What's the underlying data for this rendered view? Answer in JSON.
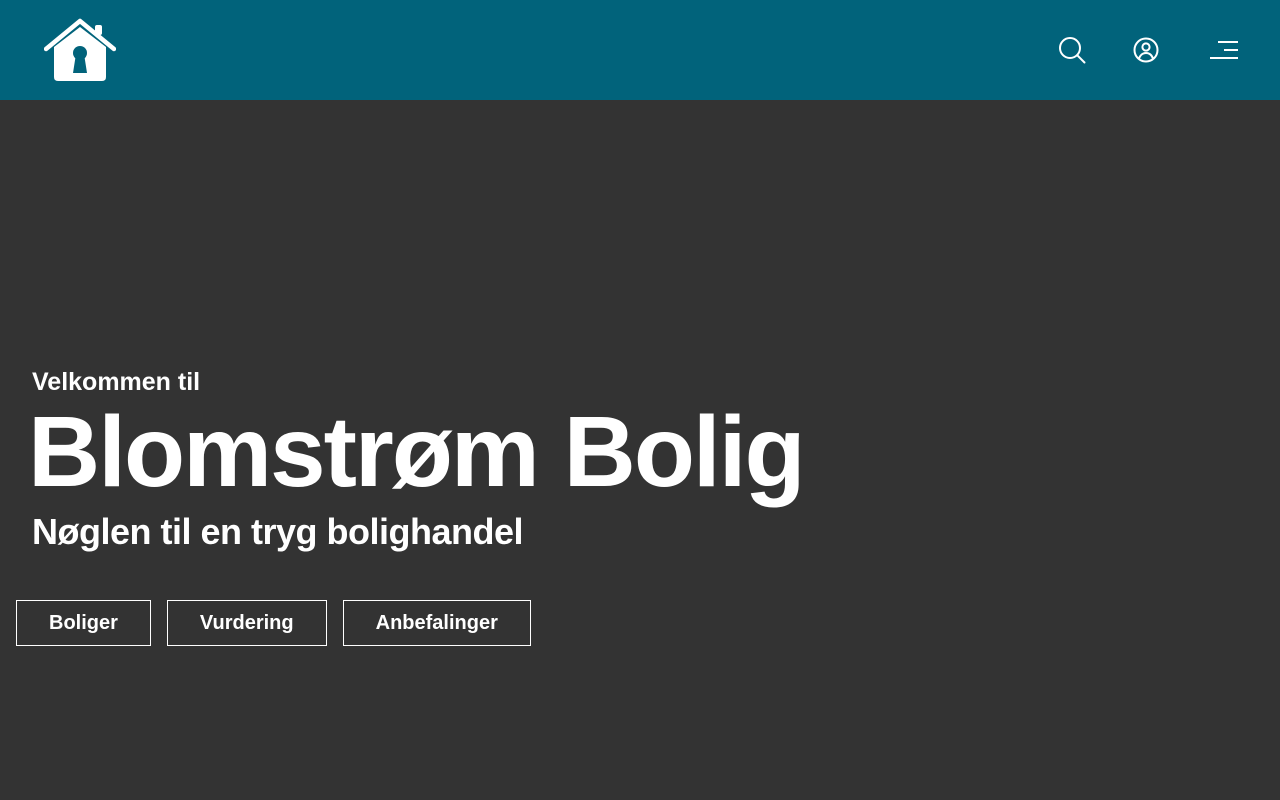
{
  "header": {
    "logo_icon": "house-keyhole-icon",
    "icons": [
      "search-icon",
      "user-circle-icon",
      "hamburger-menu-icon"
    ]
  },
  "hero": {
    "welcome": "Velkommen til",
    "title": "Blomstrøm Bolig",
    "tagline": "Nøglen til en tryg bolighandel"
  },
  "buttons": [
    {
      "label": "Boliger"
    },
    {
      "label": "Vurdering"
    },
    {
      "label": "Anbefalinger"
    }
  ],
  "colors": {
    "header_bg": "#01637b",
    "hero_bg": "#333333",
    "text": "#ffffff"
  }
}
